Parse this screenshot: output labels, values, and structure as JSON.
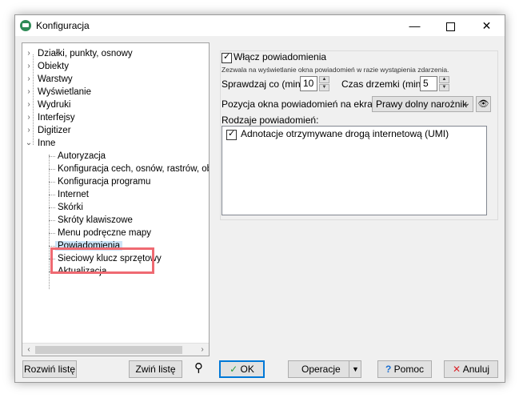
{
  "window": {
    "title": "Konfiguracja"
  },
  "tree": {
    "top_items": [
      {
        "label": "Działki, punkty, osnowy"
      },
      {
        "label": "Obiekty"
      },
      {
        "label": "Warstwy"
      },
      {
        "label": "Wyświetlanie"
      },
      {
        "label": "Wydruki"
      },
      {
        "label": "Interfejsy"
      },
      {
        "label": "Digitizer"
      },
      {
        "label": "Inne"
      }
    ],
    "children": [
      {
        "label": "Autoryzacja"
      },
      {
        "label": "Konfiguracja cech, osnów, rastrów, obsza"
      },
      {
        "label": "Konfiguracja programu"
      },
      {
        "label": "Internet"
      },
      {
        "label": "Skórki"
      },
      {
        "label": "Skróty klawiszowe"
      },
      {
        "label": "Menu podręczne mapy"
      },
      {
        "label": "Powiadomienia"
      },
      {
        "label": "Sieciowy klucz sprzętowy"
      },
      {
        "label": "Aktualizacja"
      }
    ],
    "selected": "Powiadomienia"
  },
  "settings": {
    "enable_label": "Włącz powiadomienia",
    "enable_desc": "Zezwala na wyświetlanie okna powiadomień w razie wystąpienia zdarzenia.",
    "check_label": "Sprawdzaj co (min):",
    "check_value": "10",
    "snooze_label": "Czas drzemki (min):",
    "snooze_value": "5",
    "position_label": "Pozycja okna powiadomień na ekranie",
    "position_value": "Prawy dolny narożnik",
    "types_label": "Rodzaje powiadomień:",
    "types": [
      {
        "label": "Adnotacje otrzymywane drogą internetową (UMI)"
      }
    ]
  },
  "buttons": {
    "expand": "Rozwiń listę",
    "collapse": "Zwiń listę",
    "ok": "OK",
    "operations": "Operacje",
    "help": "Pomoc",
    "cancel": "Anuluj"
  }
}
